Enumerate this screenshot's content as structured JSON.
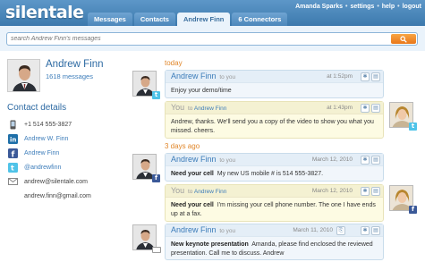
{
  "app": {
    "logo": "silentale"
  },
  "top_links": {
    "user": "Amanda Sparks",
    "settings": "settings",
    "help": "help",
    "logout": "logout"
  },
  "tabs": [
    {
      "label": "Messages"
    },
    {
      "label": "Contacts"
    },
    {
      "label": "Andrew Finn"
    },
    {
      "label": "6 Connectors"
    }
  ],
  "search": {
    "placeholder": "search Andrew Finn's messages",
    "value": ""
  },
  "profile": {
    "name": "Andrew Finn",
    "message_count": "1618 messages"
  },
  "contact_details": {
    "title": "Contact details",
    "items": [
      {
        "icon": "phone-icon",
        "text": "+1 514 555-3827"
      },
      {
        "icon": "linkedin-icon",
        "text": "Andrew W. Finn"
      },
      {
        "icon": "facebook-icon",
        "text": "Andrew Finn"
      },
      {
        "icon": "twitter-icon",
        "text": "@andrewfinn"
      },
      {
        "icon": "email-icon",
        "text": "andrew@silentale.com"
      },
      {
        "icon": "",
        "text": "andrew.finn@gmail.com"
      }
    ]
  },
  "conversation": {
    "days": [
      {
        "label": "today"
      },
      {
        "label": "3 days ago"
      }
    ],
    "messages": [
      {
        "from": "Andrew Finn",
        "to_prefix": "to",
        "to": "you",
        "time": "at 1:52pm",
        "subject": "",
        "body": "Enjoy your demo/time",
        "network": "twitter-icon"
      },
      {
        "from": "You",
        "to_prefix": "to",
        "to": "Andrew Finn",
        "time": "at 1:43pm",
        "subject": "",
        "body": "Andrew, thanks. We'll send you a copy of the video to show you what you missed. cheers.",
        "network": "twitter-icon"
      },
      {
        "from": "Andrew Finn",
        "to_prefix": "to",
        "to": "you",
        "time": "March 12, 2010",
        "subject": "Need your cell",
        "body": "My new US mobile # is 514 555-3827.",
        "network": "facebook-icon"
      },
      {
        "from": "You",
        "to_prefix": "to",
        "to": "Andrew Finn",
        "time": "March 12, 2010",
        "subject": "Need your cell",
        "body": "I'm missing your cell phone number. The one I have ends up at a fax.",
        "network": "facebook-icon"
      },
      {
        "from": "Andrew Finn",
        "to_prefix": "to",
        "to": "you",
        "time": "March 11, 2010",
        "subject": "New keynote presentation",
        "body": "Amanda, please find enclosed the reviewed presentation. Call me to discuss. Andrew",
        "network": "email-icon"
      }
    ]
  },
  "colors": {
    "header": "#3c79ad",
    "accent_orange": "#e9781a",
    "link_blue": "#3d7dba",
    "incoming_bg": "#f1f6fb",
    "outgoing_bg": "#fdfbe3"
  }
}
